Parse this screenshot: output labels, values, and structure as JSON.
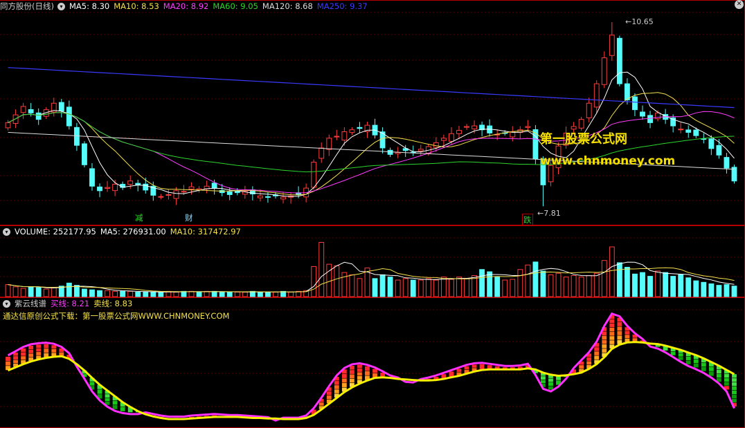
{
  "price_header": {
    "title": "同方股份(日线)",
    "ma_items": [
      {
        "label": "MA5: 8.30",
        "color": "#ffffff"
      },
      {
        "label": "MA10: 8.53",
        "color": "#f5e04b"
      },
      {
        "label": "MA20: 8.92",
        "color": "#ff3cff"
      },
      {
        "label": "MA60: 9.05",
        "color": "#2cd62c"
      },
      {
        "label": "MA120: 8.68",
        "color": "#dddddd"
      },
      {
        "label": "MA250: 9.37",
        "color": "#3a3aff"
      }
    ]
  },
  "volume_header": {
    "items": [
      {
        "label": "VOLUME: 252177.95",
        "color": "#ffffff"
      },
      {
        "label": "MA5: 276931.00",
        "color": "#ffffff"
      },
      {
        "label": "MA10: 317472.97",
        "color": "#f5e04b"
      }
    ]
  },
  "indicator_header": {
    "name": "紫云线谱",
    "buy": "买线: 8.21",
    "sell": "卖线: 8.83",
    "subtitle": "通达信原创公式下载：第一股票公式网WWW.CHNMONEY.COM"
  },
  "watermark": {
    "line1": "第一股票公式网",
    "line2": "www.chnmoney.com"
  },
  "markers": [
    {
      "text": "减",
      "color": "#2cd62c"
    },
    {
      "text": "财",
      "color": "#8cdcff"
    },
    {
      "text": "跌",
      "color": "#2cd62c"
    }
  ],
  "high_label": "10.65",
  "low_label": "7.81",
  "colors": {
    "up": "#ff3c3c",
    "down": "#54fcfc",
    "grid": "#5a0000",
    "frame": "#b40000"
  },
  "chart_data": {
    "type": "candlestick",
    "y_range": [
      7.6,
      10.8
    ],
    "highest": 10.65,
    "lowest": 7.81,
    "close": [
      9.1,
      9.22,
      9.35,
      9.25,
      9.15,
      9.3,
      9.4,
      9.28,
      9.05,
      8.75,
      8.45,
      8.12,
      8.05,
      8.1,
      8.15,
      8.1,
      8.2,
      8.14,
      8.06,
      7.98,
      7.96,
      7.99,
      8.05,
      8.04,
      8.11,
      8.08,
      8.12,
      8.09,
      8.02,
      7.99,
      8.02,
      8.04,
      8.0,
      7.97,
      7.95,
      7.97,
      7.95,
      7.97,
      7.99,
      8.09,
      8.49,
      8.71,
      8.86,
      8.89,
      8.96,
      8.99,
      9.01,
      9.06,
      8.91,
      8.71,
      8.61,
      8.64,
      8.67,
      8.64,
      8.69,
      8.73,
      8.79,
      8.86,
      8.93,
      8.98,
      9.04,
      9.05,
      8.99,
      8.94,
      8.92,
      8.94,
      8.96,
      8.99,
      9.04,
      8.54,
      8.14,
      8.44,
      8.74,
      8.94,
      9.04,
      9.15,
      9.4,
      9.7,
      10.1,
      10.45,
      9.7,
      9.45,
      9.3,
      9.2,
      9.1,
      9.25,
      9.15,
      9.05,
      9.0,
      8.95,
      8.9,
      8.85,
      8.7,
      8.6,
      8.4,
      8.2
    ],
    "volume": [
      0.16,
      0.13,
      0.11,
      0.13,
      0.12,
      0.1,
      0.12,
      0.14,
      0.18,
      0.15,
      0.1,
      0.09,
      0.08,
      0.08,
      0.07,
      0.07,
      0.07,
      0.06,
      0.06,
      0.06,
      0.06,
      0.07,
      0.06,
      0.07,
      0.07,
      0.06,
      0.07,
      0.07,
      0.06,
      0.06,
      0.06,
      0.06,
      0.07,
      0.06,
      0.06,
      0.06,
      0.07,
      0.06,
      0.07,
      0.08,
      0.4,
      0.72,
      0.43,
      0.41,
      0.32,
      0.29,
      0.24,
      0.38,
      0.24,
      0.29,
      0.26,
      0.22,
      0.24,
      0.22,
      0.22,
      0.24,
      0.22,
      0.26,
      0.23,
      0.26,
      0.24,
      0.28,
      0.36,
      0.33,
      0.26,
      0.22,
      0.23,
      0.36,
      0.42,
      0.46,
      0.34,
      0.29,
      0.31,
      0.26,
      0.28,
      0.26,
      0.28,
      0.31,
      0.48,
      0.66,
      0.45,
      0.39,
      0.3,
      0.32,
      0.27,
      0.34,
      0.32,
      0.27,
      0.29,
      0.25,
      0.21,
      0.19,
      0.17,
      0.15,
      0.16,
      0.14
    ],
    "buy_line": [
      8.9,
      8.96,
      9.02,
      9.07,
      9.11,
      9.14,
      9.16,
      9.17,
      9.12,
      9.02,
      8.9,
      8.76,
      8.63,
      8.52,
      8.41,
      8.3,
      8.21,
      8.13,
      8.07,
      8.03,
      8.0,
      7.98,
      7.98,
      7.98,
      7.99,
      8.0,
      8.01,
      8.02,
      8.02,
      8.02,
      8.02,
      8.01,
      8.0,
      8.0,
      7.99,
      7.99,
      7.98,
      7.98,
      7.98,
      8.0,
      8.06,
      8.16,
      8.27,
      8.38,
      8.49,
      8.58,
      8.65,
      8.71,
      8.76,
      8.77,
      8.76,
      8.74,
      8.73,
      8.72,
      8.71,
      8.71,
      8.72,
      8.74,
      8.77,
      8.8,
      8.84,
      8.88,
      8.91,
      8.92,
      8.92,
      8.92,
      8.92,
      8.92,
      8.94,
      8.92,
      8.86,
      8.82,
      8.8,
      8.81,
      8.83,
      8.86,
      8.93,
      9.02,
      9.15,
      9.31,
      9.39,
      9.43,
      9.44,
      9.43,
      9.41,
      9.4,
      9.37,
      9.33,
      9.29,
      9.24,
      9.19,
      9.13,
      9.06,
      8.99,
      8.91,
      8.83
    ],
    "sell_line": [
      9.16,
      9.24,
      9.32,
      9.37,
      9.39,
      9.4,
      9.38,
      9.32,
      9.2,
      9.0,
      8.77,
      8.53,
      8.36,
      8.24,
      8.16,
      8.12,
      8.1,
      8.1,
      8.08,
      8.05,
      8.02,
      8.0,
      8.0,
      8.0,
      8.02,
      8.03,
      8.04,
      8.05,
      8.04,
      8.03,
      8.03,
      8.02,
      8.01,
      8.0,
      7.99,
      7.98,
      7.98,
      7.98,
      7.98,
      8.02,
      8.16,
      8.36,
      8.58,
      8.78,
      8.92,
      8.99,
      9.01,
      8.98,
      8.93,
      8.86,
      8.78,
      8.74,
      8.71,
      8.7,
      8.71,
      8.74,
      8.78,
      8.83,
      8.88,
      8.93,
      8.98,
      9.01,
      9.02,
      9.0,
      8.98,
      8.96,
      8.96,
      8.97,
      9.0,
      8.84,
      8.58,
      8.53,
      8.62,
      8.77,
      8.92,
      9.07,
      9.22,
      9.42,
      9.72,
      9.95,
      9.9,
      9.72,
      9.58,
      9.47,
      9.38,
      9.34,
      9.27,
      9.18,
      9.09,
      9.01,
      8.95,
      8.88,
      8.79,
      8.68,
      8.53,
      8.21
    ]
  }
}
